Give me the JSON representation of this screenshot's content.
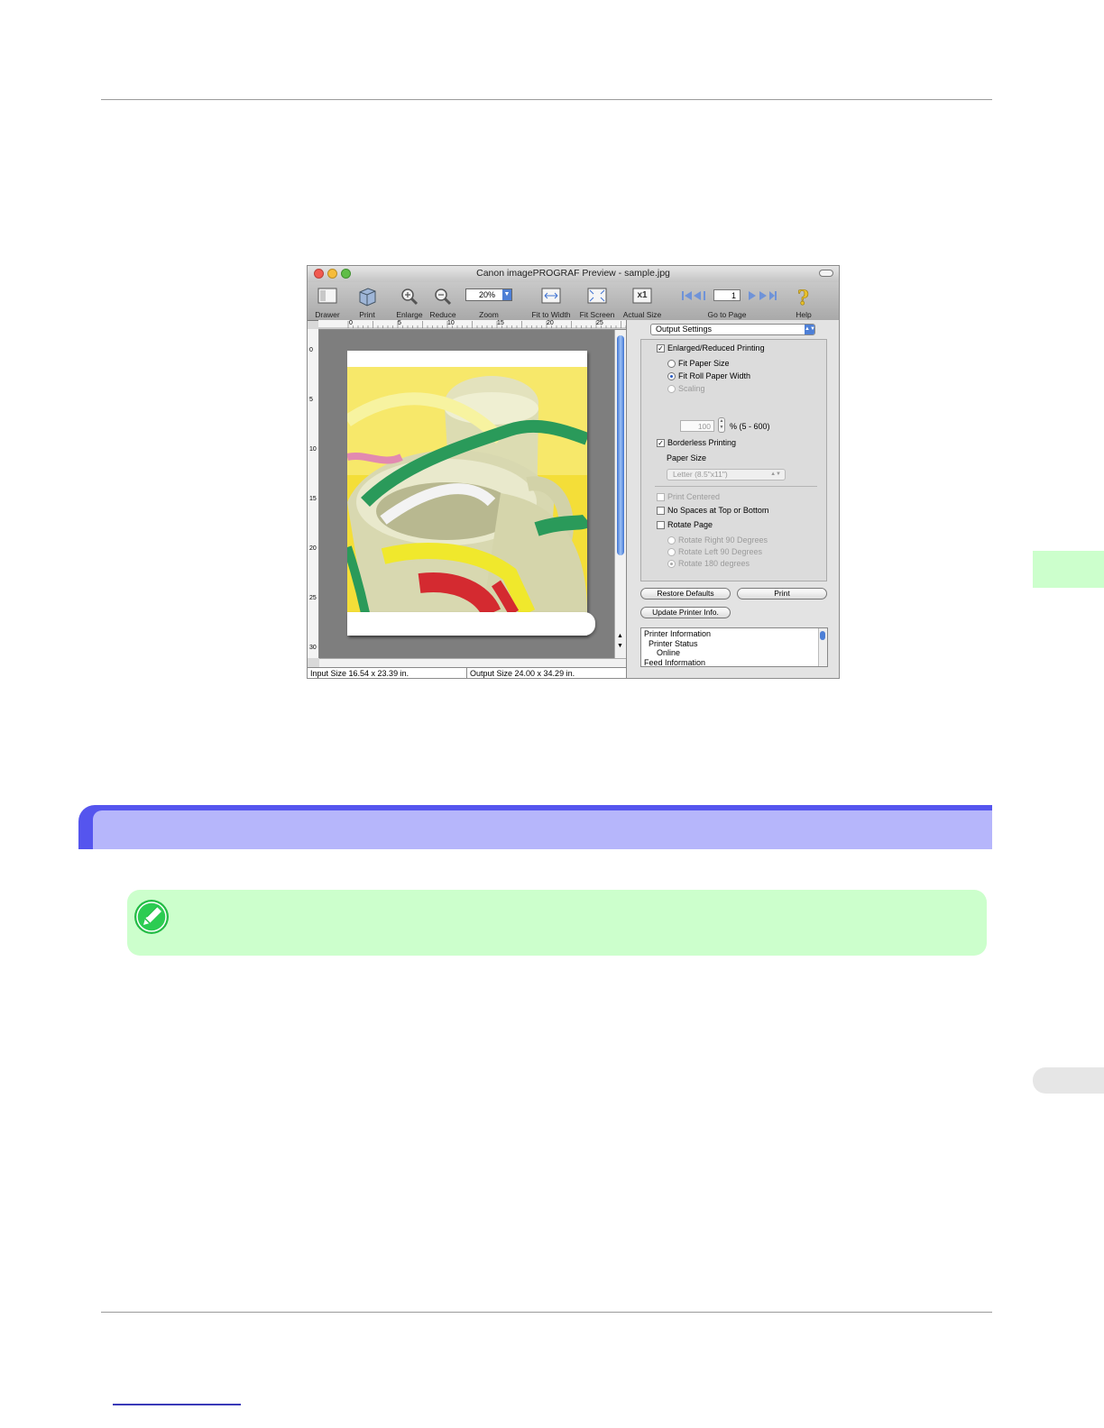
{
  "window": {
    "title": "Canon imagePROGRAF Preview - sample.jpg"
  },
  "toolbar": {
    "drawer": "Drawer",
    "print": "Print",
    "enlarge": "Enlarge",
    "reduce": "Reduce",
    "zoom_label": "Zoom",
    "zoom_value": "20%",
    "fit_to_width": "Fit to Width",
    "fit_screen": "Fit Screen",
    "actual_size": "Actual Size",
    "actual_size_glyph": "x1",
    "go_to_page": "Go to Page",
    "page_value": "1",
    "help": "Help"
  },
  "ruler": {
    "h_ticks": [
      "0",
      "5",
      "10",
      "15",
      "20",
      "25"
    ],
    "v_ticks": [
      "0",
      "5",
      "10",
      "15",
      "20",
      "25",
      "30"
    ]
  },
  "status": {
    "input_size": "Input Size 16.54 x 23.39 in.",
    "output_size": "Output Size 24.00 x 34.29 in."
  },
  "drawer": {
    "popup": "Output Settings",
    "enlarged": "Enlarged/Reduced Printing",
    "fit_paper_size": "Fit Paper Size",
    "fit_roll_paper_width": "Fit Roll Paper Width",
    "scaling": "Scaling",
    "scaling_value": "100",
    "scaling_range": "% (5 - 600)",
    "borderless": "Borderless Printing",
    "paper_size_label": "Paper Size",
    "paper_size_value": "Letter (8.5\"x11\")",
    "print_centered": "Print Centered",
    "no_spaces": "No Spaces at Top or Bottom",
    "rotate_page": "Rotate Page",
    "rotate_right": "Rotate Right 90 Degrees",
    "rotate_left": "Rotate Left 90 Degrees",
    "rotate_180": "Rotate 180 degrees",
    "restore_defaults": "Restore Defaults",
    "print_button": "Print",
    "update_printer": "Update Printer Info.",
    "info_lines": [
      "Printer Information",
      "Printer Status",
      "Online",
      "Feed Information"
    ]
  },
  "colors": {
    "section_bar": "#5555ee",
    "section_bar_inner": "#b6b6fb",
    "note_bg": "#ccffcc",
    "note_icon": "#22bb44",
    "side_tab_green": "#ccffcc",
    "side_tab_gray": "#e6e6e6"
  },
  "icons": {
    "note": "pencil-note-icon"
  }
}
